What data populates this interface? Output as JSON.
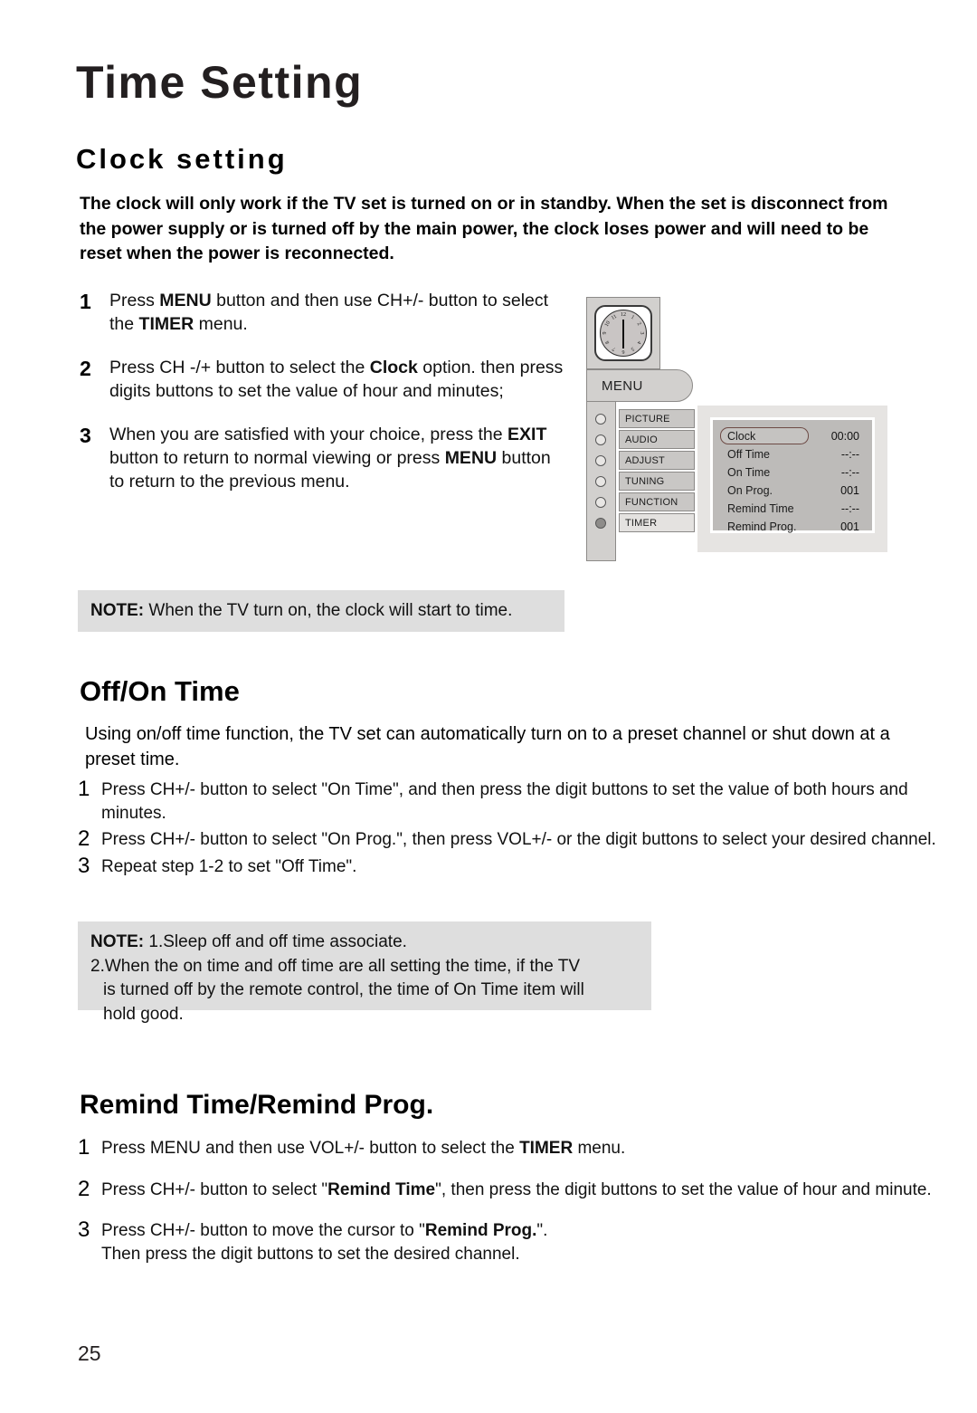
{
  "page": {
    "title": "Time Setting",
    "number": "25"
  },
  "clock_section": {
    "heading": "Clock setting",
    "intro": "The clock will only work if the TV set is  turned on or in standby. When the set is disconnect from the power supply or is turned off by the main power, the clock loses power and will need to be reset when the power is reconnected.",
    "steps": [
      {
        "num": "1",
        "text_html": "Press <b>MENU</b> button and then use CH+/- button to select the <b>TIMER</b> menu."
      },
      {
        "num": "2",
        "text_html": "Press CH -/+ button to select the <b>Clock</b> option. then press digits buttons to set the value of hour and minutes;"
      },
      {
        "num": "3",
        "text_html": "When you are satisfied with your choice, press the <b>EXIT</b> button to return to normal viewing or press <b>MENU</b> button to return to the previous menu."
      }
    ],
    "note": {
      "label": "NOTE:",
      "text": " When the TV turn on, the clock will start to time."
    }
  },
  "offon_section": {
    "heading": "Off/On Time",
    "intro": "Using on/off time function, the TV set can automatically turn on to a preset channel or shut down at a preset time.",
    "steps": [
      {
        "num": "1",
        "text_html": "Press CH+/- button to select  \"On Time\", and then press the digit buttons to set the value of both hours and minutes."
      },
      {
        "num": "2",
        "text_html": "Press CH+/- button to select  \"On Prog.\", then press VOL+/- or the digit buttons to select your desired channel."
      },
      {
        "num": "3",
        "text_html": "Repeat step 1-2 to set \"Off Time\"."
      }
    ],
    "note": {
      "label": "NOTE:",
      "line1": " 1.Sleep off and off time associate.",
      "line2": "2.When the on time and off time are all setting the time, if the TV",
      "line3": "is turned off by the remote control, the time of On Time item will",
      "line4": "hold good."
    }
  },
  "remind_section": {
    "heading": "Remind Time/Remind Prog.",
    "steps": [
      {
        "num": "1",
        "text_html": "Press MENU and then use VOL+/- button to select the <b>TIMER</b> menu."
      },
      {
        "num": "2",
        "text_html": "Press CH+/- button to select  \"<b>Remind Time</b>\", then press the digit buttons to set the value of hour and minute."
      },
      {
        "num": "3",
        "text_html": "Press CH+/- button to move the cursor to \"<b>Remind Prog.</b>\".<br>Then press the digit buttons to set the desired channel."
      }
    ]
  },
  "diagram": {
    "clock_icon_name": "analog-clock-icon",
    "clock_numerals": [
      "12",
      "1",
      "2",
      "3",
      "4",
      "5",
      "6",
      "7",
      "8",
      "9",
      "10",
      "11"
    ],
    "menu_tab_label": "MENU",
    "menu_items": [
      {
        "label": "PICTURE",
        "selected": false
      },
      {
        "label": "AUDIO",
        "selected": false
      },
      {
        "label": "ADJUST",
        "selected": false
      },
      {
        "label": "TUNING",
        "selected": false
      },
      {
        "label": "FUNCTION",
        "selected": false
      },
      {
        "label": "TIMER",
        "selected": true
      }
    ],
    "osd_rows": [
      {
        "label": "Clock",
        "value": "00:00",
        "highlighted": true
      },
      {
        "label": "Off Time",
        "value": "--:--",
        "highlighted": false
      },
      {
        "label": "On Time",
        "value": "--:--",
        "highlighted": false
      },
      {
        "label": "On Prog.",
        "value": "001",
        "highlighted": false
      },
      {
        "label": "Remind Time",
        "value": "--:--",
        "highlighted": false
      },
      {
        "label": "Remind Prog.",
        "value": "001",
        "highlighted": false
      }
    ]
  },
  "colors": {
    "note_background": "#dedede",
    "panel_gray": "#d2d0ce",
    "osd_panel": "#bdbbb9",
    "highlight_border": "#6d4a45",
    "text": "#1a1a1a"
  }
}
